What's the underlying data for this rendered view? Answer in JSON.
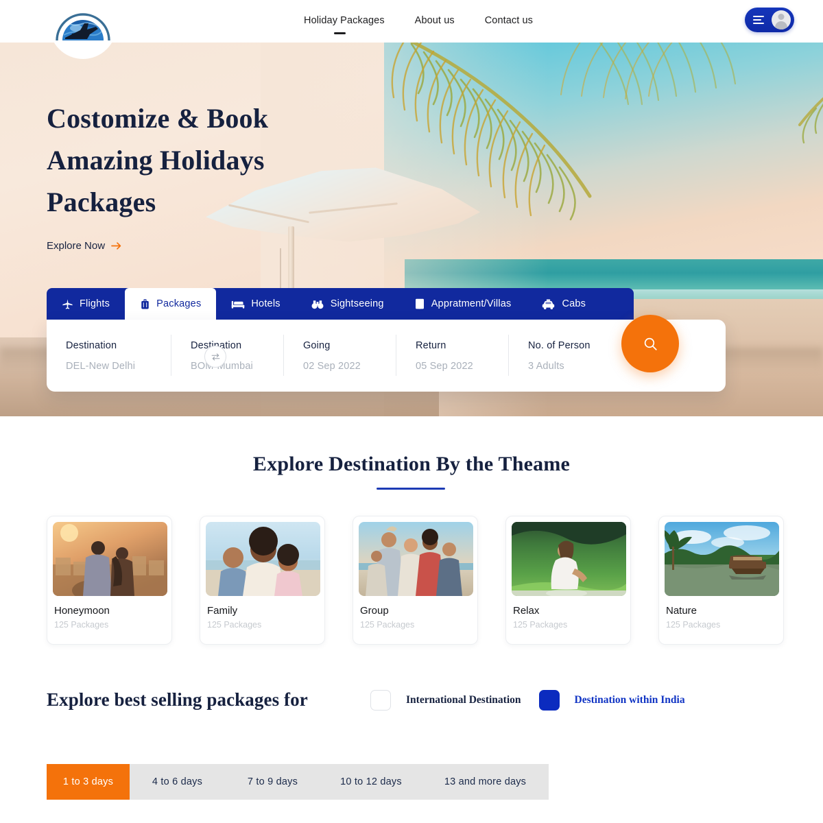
{
  "header": {
    "logo_icon": "globe-airplane-logo",
    "nav": [
      {
        "label": "Holiday Packages",
        "active": true
      },
      {
        "label": "About us",
        "active": false
      },
      {
        "label": "Contact us",
        "active": false
      }
    ],
    "account": {
      "menu_icon": "hamburger-menu-icon",
      "avatar_icon": "user-avatar-icon"
    },
    "accent_blue": "#11299e"
  },
  "hero": {
    "heading_line1": "Costomize & Book",
    "heading_line2": "Amazing Holidays",
    "heading_line3": "Packages",
    "cta_label": "Explore Now",
    "cta_icon": "arrow-right-icon",
    "cta_arrow_color": "#f4720b",
    "heading_color": "#16213f"
  },
  "search": {
    "tabs": [
      {
        "label": "Flights",
        "icon": "airplane-icon",
        "active": false
      },
      {
        "label": "Packages",
        "icon": "suitcase-icon",
        "active": true
      },
      {
        "label": "Hotels",
        "icon": "bed-icon",
        "active": false
      },
      {
        "label": "Sightseeing",
        "icon": "binoculars-icon",
        "active": false
      },
      {
        "label": "Appratment/Villas",
        "icon": "building-icon",
        "active": false
      },
      {
        "label": "Cabs",
        "icon": "taxi-icon",
        "active": false
      }
    ],
    "fields": [
      {
        "label": "Destination",
        "value": "DEL-New Delhi"
      },
      {
        "label": "Destination",
        "value": "BOM-Mumbai"
      },
      {
        "label": "Going",
        "value": "02 Sep 2022"
      },
      {
        "label": "Return",
        "value": "05 Sep 2022"
      },
      {
        "label": "No. of Person",
        "value": "3 Adults"
      }
    ],
    "swap_icon": "swap-arrows-icon",
    "search_icon": "search-icon",
    "search_button_color": "#f4720b",
    "tabbar_color": "#11299e"
  },
  "themes": {
    "title": "Explore Destination By the Theame",
    "underline_color": "#1d3bb5",
    "cards": [
      {
        "name": "Honeymoon",
        "count": "125 Packages",
        "image": "couple-sunset-city-photo"
      },
      {
        "name": "Family",
        "count": "125 Packages",
        "image": "family-beach-selfie-photo"
      },
      {
        "name": "Group",
        "count": "125 Packages",
        "image": "friends-group-celebration-photo"
      },
      {
        "name": "Relax",
        "count": "125 Packages",
        "image": "woman-meditating-mountain-photo"
      },
      {
        "name": "Nature",
        "count": "125 Packages",
        "image": "kerala-houseboat-backwater-photo"
      }
    ]
  },
  "best_selling": {
    "title": "Explore best selling packages for",
    "options": [
      {
        "label": "International Destination",
        "checked": false
      },
      {
        "label": "Destination within India",
        "checked": true
      }
    ],
    "checked_color": "#0b2bbf"
  },
  "durations": {
    "tabs": [
      {
        "label": "1 to 3 days",
        "active": true
      },
      {
        "label": "4 to 6 days",
        "active": false
      },
      {
        "label": "7 to 9 days",
        "active": false
      },
      {
        "label": "10 to 12 days",
        "active": false
      },
      {
        "label": "13 and more days",
        "active": false
      }
    ],
    "active_color": "#f4720b",
    "track_color": "#e5e5e5"
  }
}
